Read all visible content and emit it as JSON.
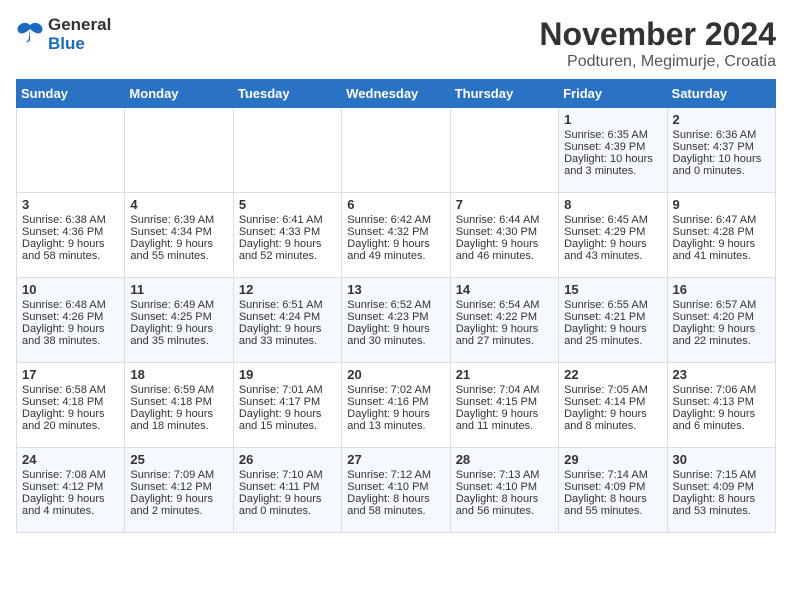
{
  "header": {
    "logo_line1": "General",
    "logo_line2": "Blue",
    "title": "November 2024",
    "subtitle": "Podturen, Megimurje, Croatia"
  },
  "weekdays": [
    "Sunday",
    "Monday",
    "Tuesday",
    "Wednesday",
    "Thursday",
    "Friday",
    "Saturday"
  ],
  "weeks": [
    [
      {
        "day": "",
        "lines": []
      },
      {
        "day": "",
        "lines": []
      },
      {
        "day": "",
        "lines": []
      },
      {
        "day": "",
        "lines": []
      },
      {
        "day": "",
        "lines": []
      },
      {
        "day": "1",
        "lines": [
          "Sunrise: 6:35 AM",
          "Sunset: 4:39 PM",
          "Daylight: 10 hours",
          "and 3 minutes."
        ]
      },
      {
        "day": "2",
        "lines": [
          "Sunrise: 6:36 AM",
          "Sunset: 4:37 PM",
          "Daylight: 10 hours",
          "and 0 minutes."
        ]
      }
    ],
    [
      {
        "day": "3",
        "lines": [
          "Sunrise: 6:38 AM",
          "Sunset: 4:36 PM",
          "Daylight: 9 hours",
          "and 58 minutes."
        ]
      },
      {
        "day": "4",
        "lines": [
          "Sunrise: 6:39 AM",
          "Sunset: 4:34 PM",
          "Daylight: 9 hours",
          "and 55 minutes."
        ]
      },
      {
        "day": "5",
        "lines": [
          "Sunrise: 6:41 AM",
          "Sunset: 4:33 PM",
          "Daylight: 9 hours",
          "and 52 minutes."
        ]
      },
      {
        "day": "6",
        "lines": [
          "Sunrise: 6:42 AM",
          "Sunset: 4:32 PM",
          "Daylight: 9 hours",
          "and 49 minutes."
        ]
      },
      {
        "day": "7",
        "lines": [
          "Sunrise: 6:44 AM",
          "Sunset: 4:30 PM",
          "Daylight: 9 hours",
          "and 46 minutes."
        ]
      },
      {
        "day": "8",
        "lines": [
          "Sunrise: 6:45 AM",
          "Sunset: 4:29 PM",
          "Daylight: 9 hours",
          "and 43 minutes."
        ]
      },
      {
        "day": "9",
        "lines": [
          "Sunrise: 6:47 AM",
          "Sunset: 4:28 PM",
          "Daylight: 9 hours",
          "and 41 minutes."
        ]
      }
    ],
    [
      {
        "day": "10",
        "lines": [
          "Sunrise: 6:48 AM",
          "Sunset: 4:26 PM",
          "Daylight: 9 hours",
          "and 38 minutes."
        ]
      },
      {
        "day": "11",
        "lines": [
          "Sunrise: 6:49 AM",
          "Sunset: 4:25 PM",
          "Daylight: 9 hours",
          "and 35 minutes."
        ]
      },
      {
        "day": "12",
        "lines": [
          "Sunrise: 6:51 AM",
          "Sunset: 4:24 PM",
          "Daylight: 9 hours",
          "and 33 minutes."
        ]
      },
      {
        "day": "13",
        "lines": [
          "Sunrise: 6:52 AM",
          "Sunset: 4:23 PM",
          "Daylight: 9 hours",
          "and 30 minutes."
        ]
      },
      {
        "day": "14",
        "lines": [
          "Sunrise: 6:54 AM",
          "Sunset: 4:22 PM",
          "Daylight: 9 hours",
          "and 27 minutes."
        ]
      },
      {
        "day": "15",
        "lines": [
          "Sunrise: 6:55 AM",
          "Sunset: 4:21 PM",
          "Daylight: 9 hours",
          "and 25 minutes."
        ]
      },
      {
        "day": "16",
        "lines": [
          "Sunrise: 6:57 AM",
          "Sunset: 4:20 PM",
          "Daylight: 9 hours",
          "and 22 minutes."
        ]
      }
    ],
    [
      {
        "day": "17",
        "lines": [
          "Sunrise: 6:58 AM",
          "Sunset: 4:18 PM",
          "Daylight: 9 hours",
          "and 20 minutes."
        ]
      },
      {
        "day": "18",
        "lines": [
          "Sunrise: 6:59 AM",
          "Sunset: 4:18 PM",
          "Daylight: 9 hours",
          "and 18 minutes."
        ]
      },
      {
        "day": "19",
        "lines": [
          "Sunrise: 7:01 AM",
          "Sunset: 4:17 PM",
          "Daylight: 9 hours",
          "and 15 minutes."
        ]
      },
      {
        "day": "20",
        "lines": [
          "Sunrise: 7:02 AM",
          "Sunset: 4:16 PM",
          "Daylight: 9 hours",
          "and 13 minutes."
        ]
      },
      {
        "day": "21",
        "lines": [
          "Sunrise: 7:04 AM",
          "Sunset: 4:15 PM",
          "Daylight: 9 hours",
          "and 11 minutes."
        ]
      },
      {
        "day": "22",
        "lines": [
          "Sunrise: 7:05 AM",
          "Sunset: 4:14 PM",
          "Daylight: 9 hours",
          "and 8 minutes."
        ]
      },
      {
        "day": "23",
        "lines": [
          "Sunrise: 7:06 AM",
          "Sunset: 4:13 PM",
          "Daylight: 9 hours",
          "and 6 minutes."
        ]
      }
    ],
    [
      {
        "day": "24",
        "lines": [
          "Sunrise: 7:08 AM",
          "Sunset: 4:12 PM",
          "Daylight: 9 hours",
          "and 4 minutes."
        ]
      },
      {
        "day": "25",
        "lines": [
          "Sunrise: 7:09 AM",
          "Sunset: 4:12 PM",
          "Daylight: 9 hours",
          "and 2 minutes."
        ]
      },
      {
        "day": "26",
        "lines": [
          "Sunrise: 7:10 AM",
          "Sunset: 4:11 PM",
          "Daylight: 9 hours",
          "and 0 minutes."
        ]
      },
      {
        "day": "27",
        "lines": [
          "Sunrise: 7:12 AM",
          "Sunset: 4:10 PM",
          "Daylight: 8 hours",
          "and 58 minutes."
        ]
      },
      {
        "day": "28",
        "lines": [
          "Sunrise: 7:13 AM",
          "Sunset: 4:10 PM",
          "Daylight: 8 hours",
          "and 56 minutes."
        ]
      },
      {
        "day": "29",
        "lines": [
          "Sunrise: 7:14 AM",
          "Sunset: 4:09 PM",
          "Daylight: 8 hours",
          "and 55 minutes."
        ]
      },
      {
        "day": "30",
        "lines": [
          "Sunrise: 7:15 AM",
          "Sunset: 4:09 PM",
          "Daylight: 8 hours",
          "and 53 minutes."
        ]
      }
    ]
  ]
}
